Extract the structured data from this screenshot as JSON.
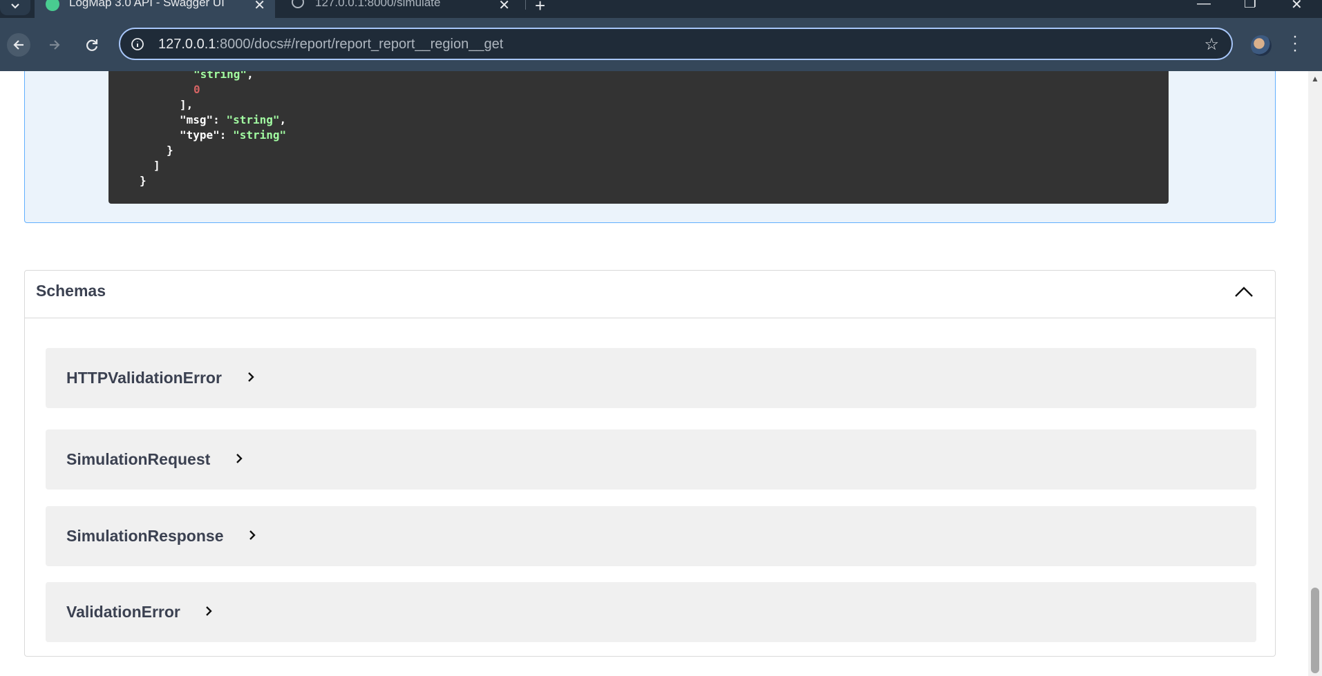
{
  "browser": {
    "tabs": [
      {
        "title": "LogMap 3.0 API - Swagger UI",
        "active": true
      },
      {
        "title": "127.0.0.1:8000/simulate",
        "active": false
      }
    ],
    "url_host": "127.0.0.1",
    "url_rest": ":8000/docs#/report/report_report__region__get"
  },
  "response_code": {
    "line1": "      ",
    "str1": "\"string\"",
    "comma": ",",
    "num1": "0",
    "close_arr": "],",
    "msg_key": "\"msg\"",
    "msg_val": "\"string\"",
    "type_key": "\"type\"",
    "type_val": "\"string\"",
    "close_obj": "}",
    "close_list": "]",
    "close_root": "}"
  },
  "schemas": {
    "title": "Schemas",
    "models": [
      {
        "name": "HTTPValidationError"
      },
      {
        "name": "SimulationRequest"
      },
      {
        "name": "SimulationResponse"
      },
      {
        "name": "ValidationError"
      }
    ]
  },
  "colors": {
    "accent_get": "#61affe",
    "code_bg": "#333333",
    "code_string": "#a2fca2",
    "code_number": "#d36363"
  }
}
